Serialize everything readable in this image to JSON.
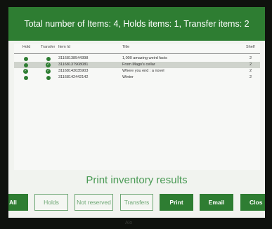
{
  "header": {
    "title": "Total number of Items: 4, Holds items: 1, Transfer items: 2"
  },
  "table": {
    "columns": {
      "hold": "Hold",
      "transfer": "Transfer",
      "item_id": "Item Id",
      "title": "Title",
      "shelf": "Shelf"
    },
    "rows": [
      {
        "item_id": "31168138544398",
        "title": "1,000 amazing weird facts",
        "shelf": "2",
        "hold": true,
        "transfer": true
      },
      {
        "item_id": "31168137908081",
        "title": "From Mago's cellar",
        "shelf": "2",
        "hold": true,
        "transfer": true
      },
      {
        "item_id": "31168143035903",
        "title": "Where you end : a novel",
        "shelf": "2",
        "hold": true,
        "transfer": true
      },
      {
        "item_id": "31168142442142",
        "title": "Winter",
        "shelf": "2",
        "hold": true,
        "transfer": true
      }
    ]
  },
  "print_title": "Print inventory results",
  "buttons": {
    "all": "All",
    "holds": "Holds",
    "not_reserved": "Not reserved",
    "transfers": "Transfers",
    "print": "Print",
    "email": "Email",
    "close": "Clos"
  },
  "bezel_label": "Alo",
  "colors": {
    "accent": "#2e7d32",
    "outline": "#6da673",
    "row_shade": "#cfd3cc"
  },
  "icons": {
    "hold": "circle-icon",
    "transfer": "check-circle-icon"
  }
}
